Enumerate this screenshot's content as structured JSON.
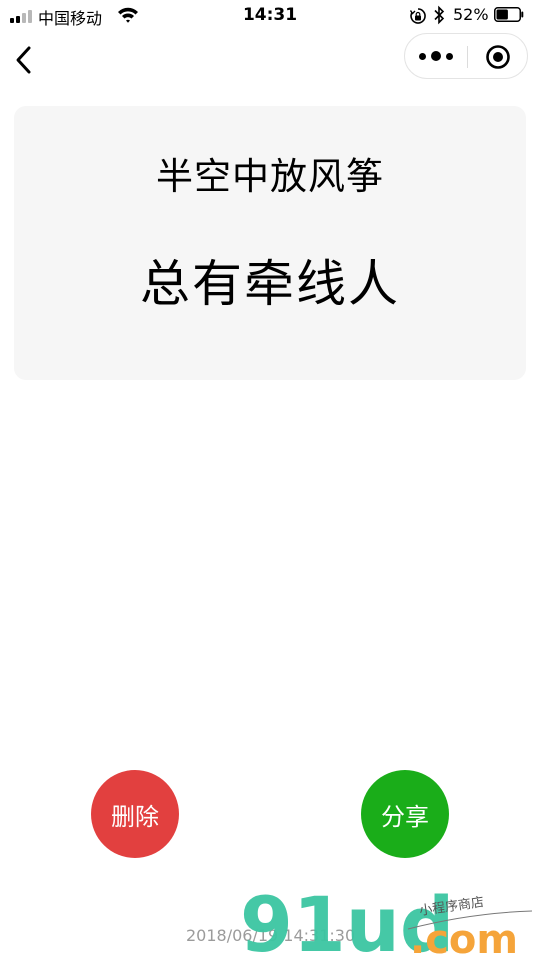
{
  "status_bar": {
    "carrier": "中国移动",
    "time": "14:31",
    "battery_percent": "52%",
    "battery_level": 0.52,
    "signal_bars": 4,
    "signal_bars_active": 2
  },
  "nav": {
    "back_icon": "chevron-left-icon",
    "more_icon": "more-dots-icon",
    "close_icon": "target-close-icon"
  },
  "card": {
    "line1": "半空中放风筝",
    "line2": "总有牵线人"
  },
  "actions": {
    "delete_label": "删除",
    "share_label": "分享"
  },
  "timestamp": "2018/06/19 14:31:30",
  "watermark": {
    "logo_text": "91ud",
    "domain_text": ".com",
    "tagline": "小程序商店"
  },
  "colors": {
    "delete": "#e2403f",
    "share": "#1aad19",
    "card_bg": "#f6f6f6",
    "watermark_green": "#3cc6a2",
    "watermark_orange": "#f5a43a"
  }
}
